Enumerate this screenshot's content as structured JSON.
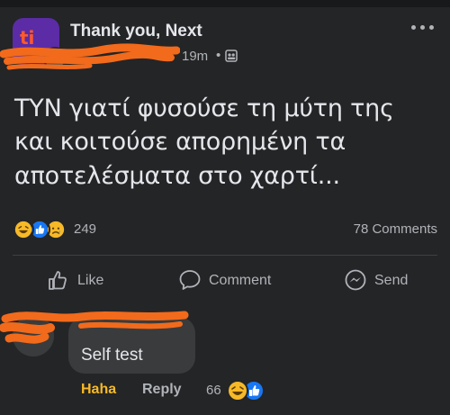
{
  "post": {
    "group_name": "Thank you, Next",
    "author_name": "",
    "time": "19m",
    "separator": "•",
    "audience_icon": "group-audience-icon",
    "more_icon": "more-dots-icon",
    "text": "ΤΥΝ γιατί φυσούσε τη μύτη της και κοιτούσε απορημένη τα αποτελέσματα στο χαρτί...",
    "reactions": [
      "haha",
      "like",
      "sad"
    ],
    "reaction_count": "249",
    "comment_count": "78 Comments"
  },
  "actions": {
    "like_label": "Like",
    "comment_label": "Comment",
    "send_label": "Send"
  },
  "comment": {
    "author_name": "",
    "text": "Self test",
    "haha_label": "Haha",
    "reply_label": "Reply",
    "reaction_count": "66",
    "reactions": [
      "haha",
      "like"
    ]
  },
  "colors": {
    "background": "#242526",
    "bubble": "#3a3b3c",
    "text_primary": "#e4e6eb",
    "text_secondary": "#b0b3b8",
    "haha_yellow": "#f7b928",
    "like_blue": "#1877f2",
    "redaction_orange": "#f26a1b"
  }
}
